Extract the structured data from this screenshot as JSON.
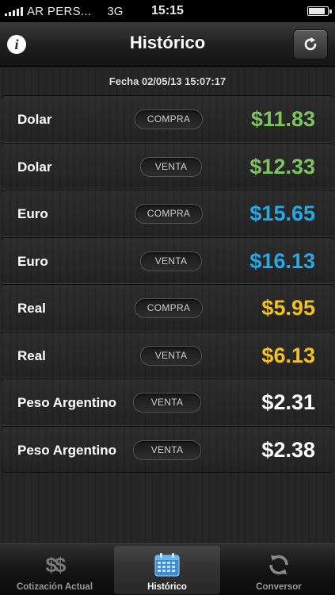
{
  "status_bar": {
    "carrier": "AR PERS...",
    "network": "3G",
    "time": "15:15",
    "battery_level": 0.9
  },
  "nav": {
    "title": "Histórico",
    "info_icon": "info-icon",
    "refresh_icon": "refresh-icon"
  },
  "date_label": "Fecha 02/05/13 15:07:17",
  "colors": {
    "dolar": "#7fc461",
    "euro": "#26a9e8",
    "real": "#f3c21b",
    "peso": "#ffffff"
  },
  "rates": [
    {
      "currency": "Dolar",
      "type": "COMPRA",
      "price": "$11.83",
      "color": "#7fc461"
    },
    {
      "currency": "Dolar",
      "type": "VENTA",
      "price": "$12.33",
      "color": "#7fc461"
    },
    {
      "currency": "Euro",
      "type": "COMPRA",
      "price": "$15.65",
      "color": "#26a9e8"
    },
    {
      "currency": "Euro",
      "type": "VENTA",
      "price": "$16.13",
      "color": "#26a9e8"
    },
    {
      "currency": "Real",
      "type": "COMPRA",
      "price": "$5.95",
      "color": "#f3c21b"
    },
    {
      "currency": "Real",
      "type": "VENTA",
      "price": "$6.13",
      "color": "#f3c21b"
    },
    {
      "currency": "Peso Argentino",
      "type": "VENTA",
      "price": "$2.31",
      "color": "#ffffff"
    },
    {
      "currency": "Peso Argentino",
      "type": "VENTA",
      "price": "$2.38",
      "color": "#ffffff"
    }
  ],
  "tabs": [
    {
      "label": "Cotización Actual",
      "icon": "dollar-icon",
      "selected": false
    },
    {
      "label": "Histórico",
      "icon": "calendar-icon",
      "selected": true
    },
    {
      "label": "Conversor",
      "icon": "sync-icon",
      "selected": false
    }
  ]
}
